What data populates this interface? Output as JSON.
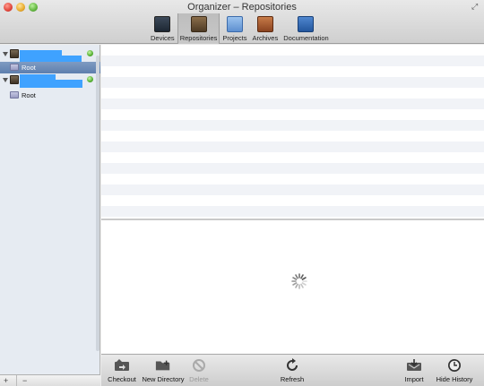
{
  "window": {
    "title": "Organizer – Repositories"
  },
  "toolbar": {
    "tabs": [
      {
        "label": "Devices",
        "icon": "devices-icon"
      },
      {
        "label": "Repositories",
        "icon": "repositories-icon",
        "active": true
      },
      {
        "label": "Projects",
        "icon": "projects-icon"
      },
      {
        "label": "Archives",
        "icon": "archives-icon"
      },
      {
        "label": "Documentation",
        "icon": "documentation-icon"
      }
    ]
  },
  "sidebar": {
    "repositories": [
      {
        "status": "green",
        "root_label": "Root",
        "root_selected": true
      },
      {
        "status": "green",
        "root_label": "Root",
        "root_selected": false
      }
    ],
    "add_label": "+",
    "remove_label": "−"
  },
  "bottom_bar": {
    "checkout": "Checkout",
    "new_directory": "New Directory",
    "delete": "Delete",
    "refresh": "Refresh",
    "import": "Import",
    "hide_history": "Hide History"
  },
  "colors": {
    "selection": "#6a8bb9",
    "redaction": "#3fa2ff",
    "status_ok": "#55b033"
  }
}
